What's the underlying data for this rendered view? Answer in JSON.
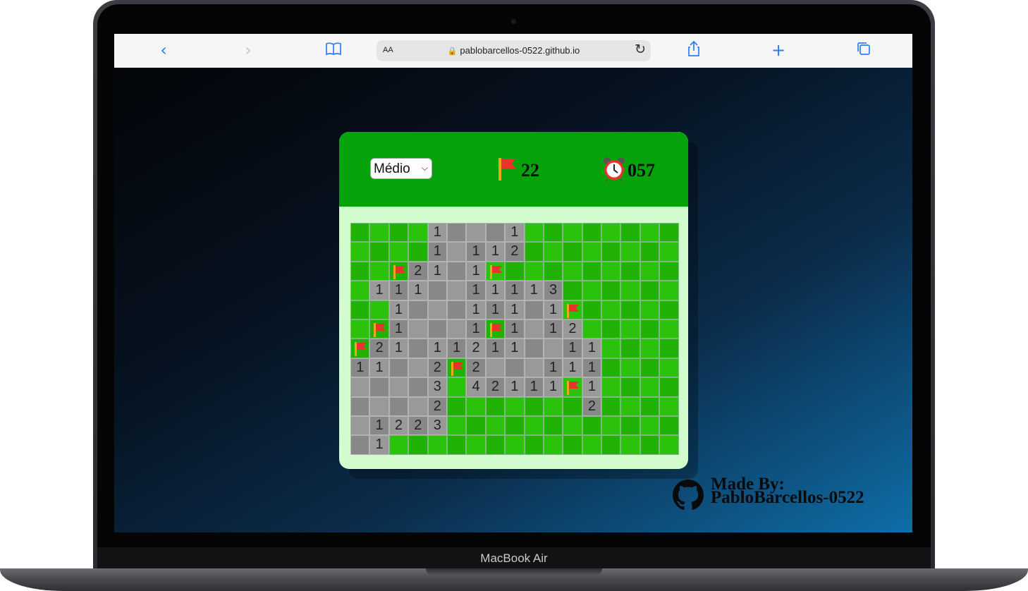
{
  "device": {
    "model_label": "MacBook Air"
  },
  "browser": {
    "text_size_label": "AA",
    "url": "pablobarcellos-0522.github.io",
    "icons": [
      "back-icon",
      "forward-icon",
      "bookmarks-icon",
      "lock-icon",
      "reload-icon",
      "share-icon",
      "new-tab-icon",
      "tabs-icon"
    ]
  },
  "game": {
    "difficulty": "Médio",
    "flags_remaining": "22",
    "timer": "057",
    "board": {
      "rows": [
        [
          "h",
          "h",
          "h",
          "h",
          "1",
          "o",
          "o",
          "o",
          "1",
          "h",
          "h",
          "h",
          "h",
          "h",
          "h",
          "h",
          "h"
        ],
        [
          "h",
          "h",
          "h",
          "h",
          "1",
          "o",
          "1",
          "1",
          "2",
          "h",
          "h",
          "h",
          "h",
          "h",
          "h",
          "h",
          "h"
        ],
        [
          "h",
          "h",
          "F",
          "2",
          "1",
          "o",
          "1",
          "F",
          "h",
          "h",
          "h",
          "h",
          "h",
          "h",
          "h",
          "h",
          "h"
        ],
        [
          "h",
          "1",
          "1",
          "1",
          "o",
          "o",
          "1",
          "1",
          "1",
          "1",
          "3",
          "h",
          "h",
          "h",
          "h",
          "h",
          "h"
        ],
        [
          "h",
          "h",
          "1",
          "o",
          "o",
          "o",
          "1",
          "1",
          "1",
          "o",
          "1",
          "F",
          "h",
          "h",
          "h",
          "h",
          "h"
        ],
        [
          "h",
          "F",
          "1",
          "o",
          "o",
          "o",
          "1",
          "F",
          "1",
          "o",
          "1",
          "2",
          "h",
          "h",
          "h",
          "h",
          "h"
        ],
        [
          "F",
          "2",
          "1",
          "o",
          "1",
          "1",
          "2",
          "1",
          "1",
          "o",
          "o",
          "1",
          "1",
          "h",
          "h",
          "h",
          "h"
        ],
        [
          "1",
          "1",
          "o",
          "o",
          "2",
          "F",
          "2",
          "o",
          "o",
          "o",
          "1",
          "1",
          "1",
          "h",
          "h",
          "h",
          "h"
        ],
        [
          "o",
          "o",
          "o",
          "o",
          "3",
          "h",
          "4",
          "2",
          "1",
          "1",
          "1",
          "F",
          "1",
          "h",
          "h",
          "h",
          "h"
        ],
        [
          "o",
          "o",
          "o",
          "o",
          "2",
          "h",
          "h",
          "h",
          "h",
          "h",
          "h",
          "h",
          "2",
          "h",
          "h",
          "h",
          "h"
        ],
        [
          "o",
          "1",
          "2",
          "2",
          "3",
          "h",
          "h",
          "h",
          "h",
          "h",
          "h",
          "h",
          "h",
          "h",
          "h",
          "h",
          "h"
        ],
        [
          "o",
          "1",
          "h",
          "h",
          "h",
          "h",
          "h",
          "h",
          "h",
          "h",
          "h",
          "h",
          "h",
          "h",
          "h",
          "h",
          "h"
        ]
      ]
    },
    "colors": {
      "header": "#05a20c",
      "card": "#d3fcce",
      "hidden_cell": "#20b305",
      "open_cell": "#999999",
      "flag": "#e8322c"
    }
  },
  "credit": {
    "line1": "Made By:",
    "line2": "PabloBarcellos-0522",
    "icon": "github-icon"
  }
}
